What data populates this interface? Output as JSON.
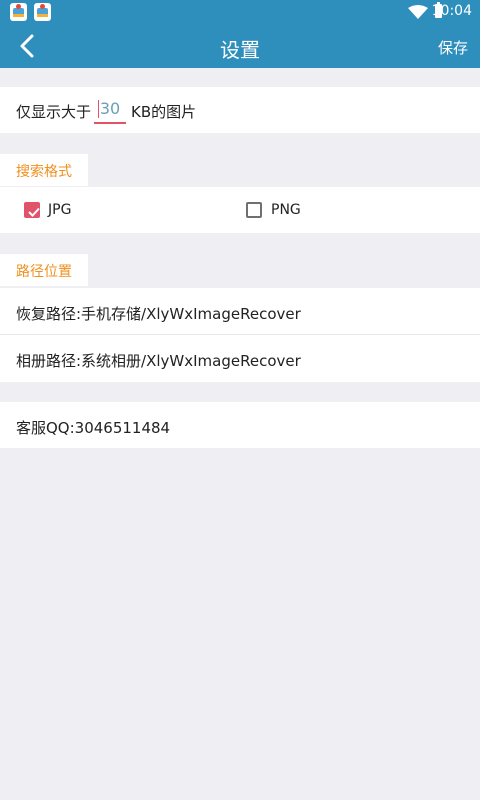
{
  "status_bar": {
    "time": "10:04",
    "icons": [
      "app-notification-icon",
      "app-notification-icon",
      "wifi-icon",
      "battery-icon"
    ]
  },
  "header": {
    "title": "设置",
    "save_label": "保存",
    "back_icon": "chevron-left-icon",
    "background_color": "#2e8fbd"
  },
  "size_filter": {
    "prefix": "仅显示大于",
    "value": "30",
    "suffix": "KB的图片"
  },
  "format_section": {
    "header": "搜索格式",
    "options": [
      {
        "label": "JPG",
        "checked": true
      },
      {
        "label": "PNG",
        "checked": false
      }
    ]
  },
  "path_section": {
    "header": "路径位置",
    "recover_path": "恢复路径:手机存储/XlyWxImageRecover",
    "album_path": "相册路径:系统相册/XlyWxImageRecover"
  },
  "support": {
    "qq": "客服QQ:3046511484"
  },
  "colors": {
    "accent": "#e0536a",
    "section_header": "#f0901e",
    "background": "#eeeef3"
  }
}
